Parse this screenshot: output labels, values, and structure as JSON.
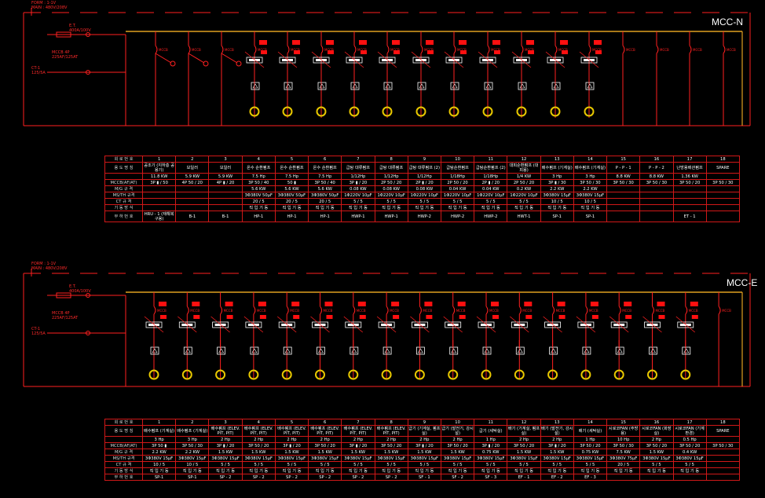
{
  "panels": [
    {
      "title": "MCC-N",
      "feed_note": [
        "FORM : 1-1V",
        "MAIN : 480V/208V"
      ],
      "main_breaker": [
        "E.T.",
        "400A/100V"
      ],
      "sub_breaker_1": [
        "MCCB  4P",
        "225AF/125AT"
      ],
      "sub_breaker_2": [
        "CT-1",
        "125/5A"
      ],
      "table": {
        "row_headers": [
          "회 로 번 호",
          "용 도 명 칭",
          "MCCB(AF/AT)",
          "M/G 규 격",
          "MS/TH 규격",
          "CT 규 격",
          "기 동 방 식",
          "부 하 번 호"
        ],
        "columns": [
          {
            "no": "1",
            "name": "공조기 (지하층 공용기)",
            "rating": "11.8   KW",
            "mccb": "3P ▮ / 50",
            "mg": "",
            "msth": "",
            "ct": "",
            "start": "",
            "load": "HRU - 1 (재해복구용)"
          },
          {
            "no": "2",
            "name": "보일러",
            "rating": "5.9   KW",
            "mccb": "4P  50  / 20",
            "mg": "",
            "msth": "",
            "ct": "",
            "start": "",
            "load": "B-1"
          },
          {
            "no": "3",
            "name": "보일러",
            "rating": "5.9   KW",
            "mccb": "4P ▮ / 20",
            "mg": "",
            "msth": "",
            "ct": "",
            "start": "",
            "load": "B-1"
          },
          {
            "no": "4",
            "name": "온수 순환펌프",
            "rating": "7.5 Hp",
            "mccb": "3P  50  / 40",
            "mg": "5.6   KW",
            "msth": "3Φ380V   50μF",
            "ct": "20  / 5",
            "start": "직 입 기 동",
            "load": "HP-1"
          },
          {
            "no": "5",
            "name": "온수 순환펌프",
            "rating": "7.5 Hp",
            "mccb": "50 ▮",
            "mg": "5.6   KW",
            "msth": "3Φ380V   50μF",
            "ct": "20  / 5",
            "start": "직 입 기 동",
            "load": "HP-1"
          },
          {
            "no": "6",
            "name": "온수 순환펌프",
            "rating": "7.5 Hp",
            "mccb": "3P  50  / 40",
            "mg": "5.6   KW",
            "msth": "3Φ380V   50μF",
            "ct": "20  / 5",
            "start": "직 입 기 동",
            "load": "HP-1"
          },
          {
            "no": "7",
            "name": "급탕 대류펌프",
            "rating": "1/12Hp",
            "mccb": "3P ▮ / 20",
            "mg": "0.08   KW",
            "msth": "1Φ220V   10μF",
            "ct": "5  / 5",
            "start": "직 입 기 동",
            "load": "HWP-1"
          },
          {
            "no": "8",
            "name": "급탕 대류펌프",
            "rating": "1/12Hp",
            "mccb": "2P  50  / 20",
            "mg": "0.08   KW",
            "msth": "1Φ220V   10μF",
            "ct": "5  / 5",
            "start": "직 입 기 동",
            "load": "HWP-1"
          },
          {
            "no": "9",
            "name": "급탕 대류펌프 (2)",
            "rating": "1/12Hp",
            "mccb": "2P ▮ / 20",
            "mg": "0.08   KW",
            "msth": "1Φ220V   10μF",
            "ct": "5  / 5",
            "start": "직 입 기 동",
            "load": "HWP-2"
          },
          {
            "no": "10",
            "name": "급탕순환펌프",
            "rating": "1/18Hp",
            "mccb": "2P  50  / 20",
            "mg": "0.04   KW",
            "msth": "1Φ220V   10μF",
            "ct": "5  / 5",
            "start": "직 입 기 동",
            "load": "HWP-2"
          },
          {
            "no": "11",
            "name": "급탕순환펌프 (2)",
            "rating": "1/18Hp",
            "mccb": "2P ▮ / 20",
            "mg": "0.04   KW",
            "msth": "1Φ220V   10μF",
            "ct": "5  / 5",
            "start": "직 입 기 동",
            "load": "HWP-2"
          },
          {
            "no": "12",
            "name": "대피순환펌프 (대피용)",
            "rating": "1/4   KW",
            "mccb": "2P  50  / 20",
            "mg": "0.2   KW",
            "msth": "1Φ220V   10μF",
            "ct": "5  / 5",
            "start": "직 입 기 동",
            "load": "HWT-1"
          },
          {
            "no": "13",
            "name": "배수펌프 (기계실)",
            "rating": "3   Hp",
            "mccb": "3P ▮ / 30",
            "mg": "2.2   KW",
            "msth": "3Φ380V   15μF",
            "ct": "10  / 5",
            "start": "직 입 기 동",
            "load": "SP-1"
          },
          {
            "no": "14",
            "name": "배수펌프 (기계실)",
            "rating": "3   Hp",
            "mccb": "3P  50  / 30",
            "mg": "2.2   KW",
            "msth": "3Φ380V   15μF",
            "ct": "10  / 5",
            "start": "직 입 기 동",
            "load": "SP-1"
          },
          {
            "no": "15",
            "name": "P - P - 1",
            "rating": "8.8   KW",
            "mccb": "3P  50  / 30",
            "mg": "",
            "msth": "",
            "ct": "",
            "start": "",
            "load": ""
          },
          {
            "no": "16",
            "name": "P - P - 2",
            "rating": "8.8   KW",
            "mccb": "3P  50  / 30",
            "mg": "",
            "msth": "",
            "ct": "",
            "start": "",
            "load": ""
          },
          {
            "no": "17",
            "name": "난방용배관펌프",
            "rating": "1.36   KW",
            "mccb": "3P  50  / 20",
            "mg": "",
            "msth": "",
            "ct": "",
            "start": "",
            "load": "ET - 1"
          },
          {
            "no": "18",
            "name": "SPARE",
            "rating": "",
            "mccb": "3P  50  / 30",
            "mg": "",
            "msth": "",
            "ct": "",
            "start": "",
            "load": ""
          }
        ]
      }
    },
    {
      "title": "MCC-E",
      "feed_note": [
        "FORM : 1-1V",
        "MAIN : 480V/208V"
      ],
      "main_breaker": [
        "E.T.",
        "400A/100V"
      ],
      "sub_breaker_1": [
        "MCCB  4P",
        "225AF/125AT"
      ],
      "sub_breaker_2": [
        "CT-1",
        "125/5A"
      ],
      "table": {
        "row_headers": [
          "회 로 번 호",
          "용 도 명 칭",
          "MCCB(AF/AT)",
          "M/G 규 격",
          "MS/TH 규격",
          "CT 규 격",
          "기 동 방 식",
          "부 하 번 호"
        ],
        "columns": [
          {
            "no": "1",
            "name": "배수펌프 (기계실)",
            "rating": "3   Hp",
            "mccb": "3P  50 ▮",
            "mg": "2.2   KW",
            "msth": "3Φ380V   15μF",
            "ct": "10  / 5",
            "start": "직 입 기 동",
            "load": "SP-1"
          },
          {
            "no": "2",
            "name": "배수펌프 (기계실)",
            "rating": "3   Hp",
            "mccb": "3P  50  / 30",
            "mg": "2.2   KW",
            "msth": "3Φ380V   15μF",
            "ct": "10  / 5",
            "start": "직 입 기 동",
            "load": "SP-1"
          },
          {
            "no": "3",
            "name": "배수펌프 (ELEV. PIT, PIT)",
            "rating": "2   Hp",
            "mccb": "3P ▮ / 20",
            "mg": "1.5   KW",
            "msth": "3Φ380V   15μF",
            "ct": "5  / 5",
            "start": "직 입 기 동",
            "load": "SP - 2"
          },
          {
            "no": "4",
            "name": "배수펌프 (ELEV. PIT, PIT)",
            "rating": "2   Hp",
            "mccb": "3P  50  / 20",
            "mg": "1.5   KW",
            "msth": "3Φ380V   15μF",
            "ct": "5  / 5",
            "start": "직 입 기 동",
            "load": "SP - 2"
          },
          {
            "no": "5",
            "name": "배수펌프 (ELEV. PIT, PIT)",
            "rating": "2   Hp",
            "mccb": "3P ▮ / 20",
            "mg": "1.5   KW",
            "msth": "3Φ380V   15μF",
            "ct": "5  / 5",
            "start": "직 입 기 동",
            "load": "SP - 2"
          },
          {
            "no": "6",
            "name": "배수펌프 (ELEV. PIT, PIT)",
            "rating": "2   Hp",
            "mccb": "3P  50  / 20",
            "mg": "1.5   KW",
            "msth": "3Φ380V   15μF",
            "ct": "5  / 5",
            "start": "직 입 기 동",
            "load": "SP - 2"
          },
          {
            "no": "7",
            "name": "배수펌프 (ELEV. PIT, PIT)",
            "rating": "2   Hp",
            "mccb": "3P ▮ / 20",
            "mg": "1.5   KW",
            "msth": "3Φ380V   15μF",
            "ct": "5  / 5",
            "start": "직 입 기 동",
            "load": "SP - 2"
          },
          {
            "no": "8",
            "name": "배수펌프 (ELEV. PIT, PIT)",
            "rating": "2   Hp",
            "mccb": "3P  50  / 20",
            "mg": "1.5   KW",
            "msth": "3Φ380V   15μF",
            "ct": "5  / 5",
            "start": "직 입 기 동",
            "load": "SP - 2"
          },
          {
            "no": "9",
            "name": "급기 (기계실, 펌프실)",
            "rating": "2   Hp",
            "mccb": "3P ▮ / 20",
            "mg": "1.5   KW",
            "msth": "3Φ380V   15μF",
            "ct": "5  / 5",
            "start": "직 입 기 동",
            "load": "SF - 1"
          },
          {
            "no": "10",
            "name": "급기 (발전기, 강시설)",
            "rating": "2   Hp",
            "mccb": "3P  50  / 20",
            "mg": "1.5   KW",
            "msth": "3Φ380V   15μF",
            "ct": "5  / 5",
            "start": "직 입 기 동",
            "load": "SF - 2"
          },
          {
            "no": "11",
            "name": "급기 (세탁실)",
            "rating": "1   Hp",
            "mccb": "3P ▮ / 20",
            "mg": "0.75   KW",
            "msth": "3Φ380V   15μF",
            "ct": "5  / 5",
            "start": "직 입 기 동",
            "load": "SF - 3"
          },
          {
            "no": "12",
            "name": "배기 (기계실, 펌프실)",
            "rating": "2   Hp",
            "mccb": "3P  50  / 20",
            "mg": "1.5   KW",
            "msth": "3Φ380V   15μF",
            "ct": "5  / 5",
            "start": "직 입 기 동",
            "load": "EF - 1"
          },
          {
            "no": "13",
            "name": "배기 (발전기, 강시설)",
            "rating": "2   Hp",
            "mccb": "3P ▮ / 20",
            "mg": "1.5   KW",
            "msth": "3Φ380V   15μF",
            "ct": "5  / 5",
            "start": "직 입 기 동",
            "load": "EF - 2"
          },
          {
            "no": "14",
            "name": "배기 (세탁실)",
            "rating": "1   Hp",
            "mccb": "3P  50  / 20",
            "mg": "0.75   KW",
            "msth": "3Φ380V   15μF",
            "ct": "5  / 5",
            "start": "직 입 기 동",
            "load": "EF - 3"
          },
          {
            "no": "15",
            "name": "시로코FAN (주방용)",
            "rating": "10   Hp",
            "mccb": "3P  50  / 30",
            "mg": "7.5   KW",
            "msth": "3Φ380V   75μF",
            "ct": "20  / 5",
            "start": "직 입 기 동",
            "load": ""
          },
          {
            "no": "16",
            "name": "시로코FAN (화장실)",
            "rating": "2   Hp",
            "mccb": "3P  50  / 20",
            "mg": "1.5   KW",
            "msth": "3Φ380V   15μF",
            "ct": "5  / 5",
            "start": "직 입 기 동",
            "load": ""
          },
          {
            "no": "17",
            "name": "시로코FAN (기계환경)",
            "rating": "0.5 Hp",
            "mccb": "3P  50  / 20",
            "mg": "0.4   KW",
            "msth": "3Φ380V   15μF",
            "ct": "5  / 5",
            "start": "직 입 기 동",
            "load": ""
          },
          {
            "no": "18",
            "name": "SPARE",
            "rating": "",
            "mccb": "3P  50  / 30",
            "mg": "",
            "msth": "",
            "ct": "",
            "start": "",
            "load": ""
          }
        ]
      }
    }
  ],
  "colors": {
    "wire": "#ff2020",
    "bus": "#e0a020",
    "motor_ring": "#e8c800",
    "breaker_fill": "#ff1010",
    "table_border": "#d01818",
    "background": "#000000"
  }
}
